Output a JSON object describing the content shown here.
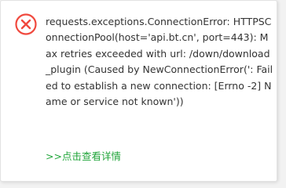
{
  "dialog": {
    "icon": "error-circle-x-icon",
    "icon_color": "#f0493e",
    "message": "requests.exceptions.ConnectionError: HTTPSConnectionPool(host='api.bt.cn', port=443): Max retries exceeded with url: /down/download_plugin (Caused by NewConnectionError(': Failed to establish a new connection: [Errno -2] Name or service not known'))",
    "details_link": ">>点击查看详情",
    "link_color": "#20a53a"
  }
}
